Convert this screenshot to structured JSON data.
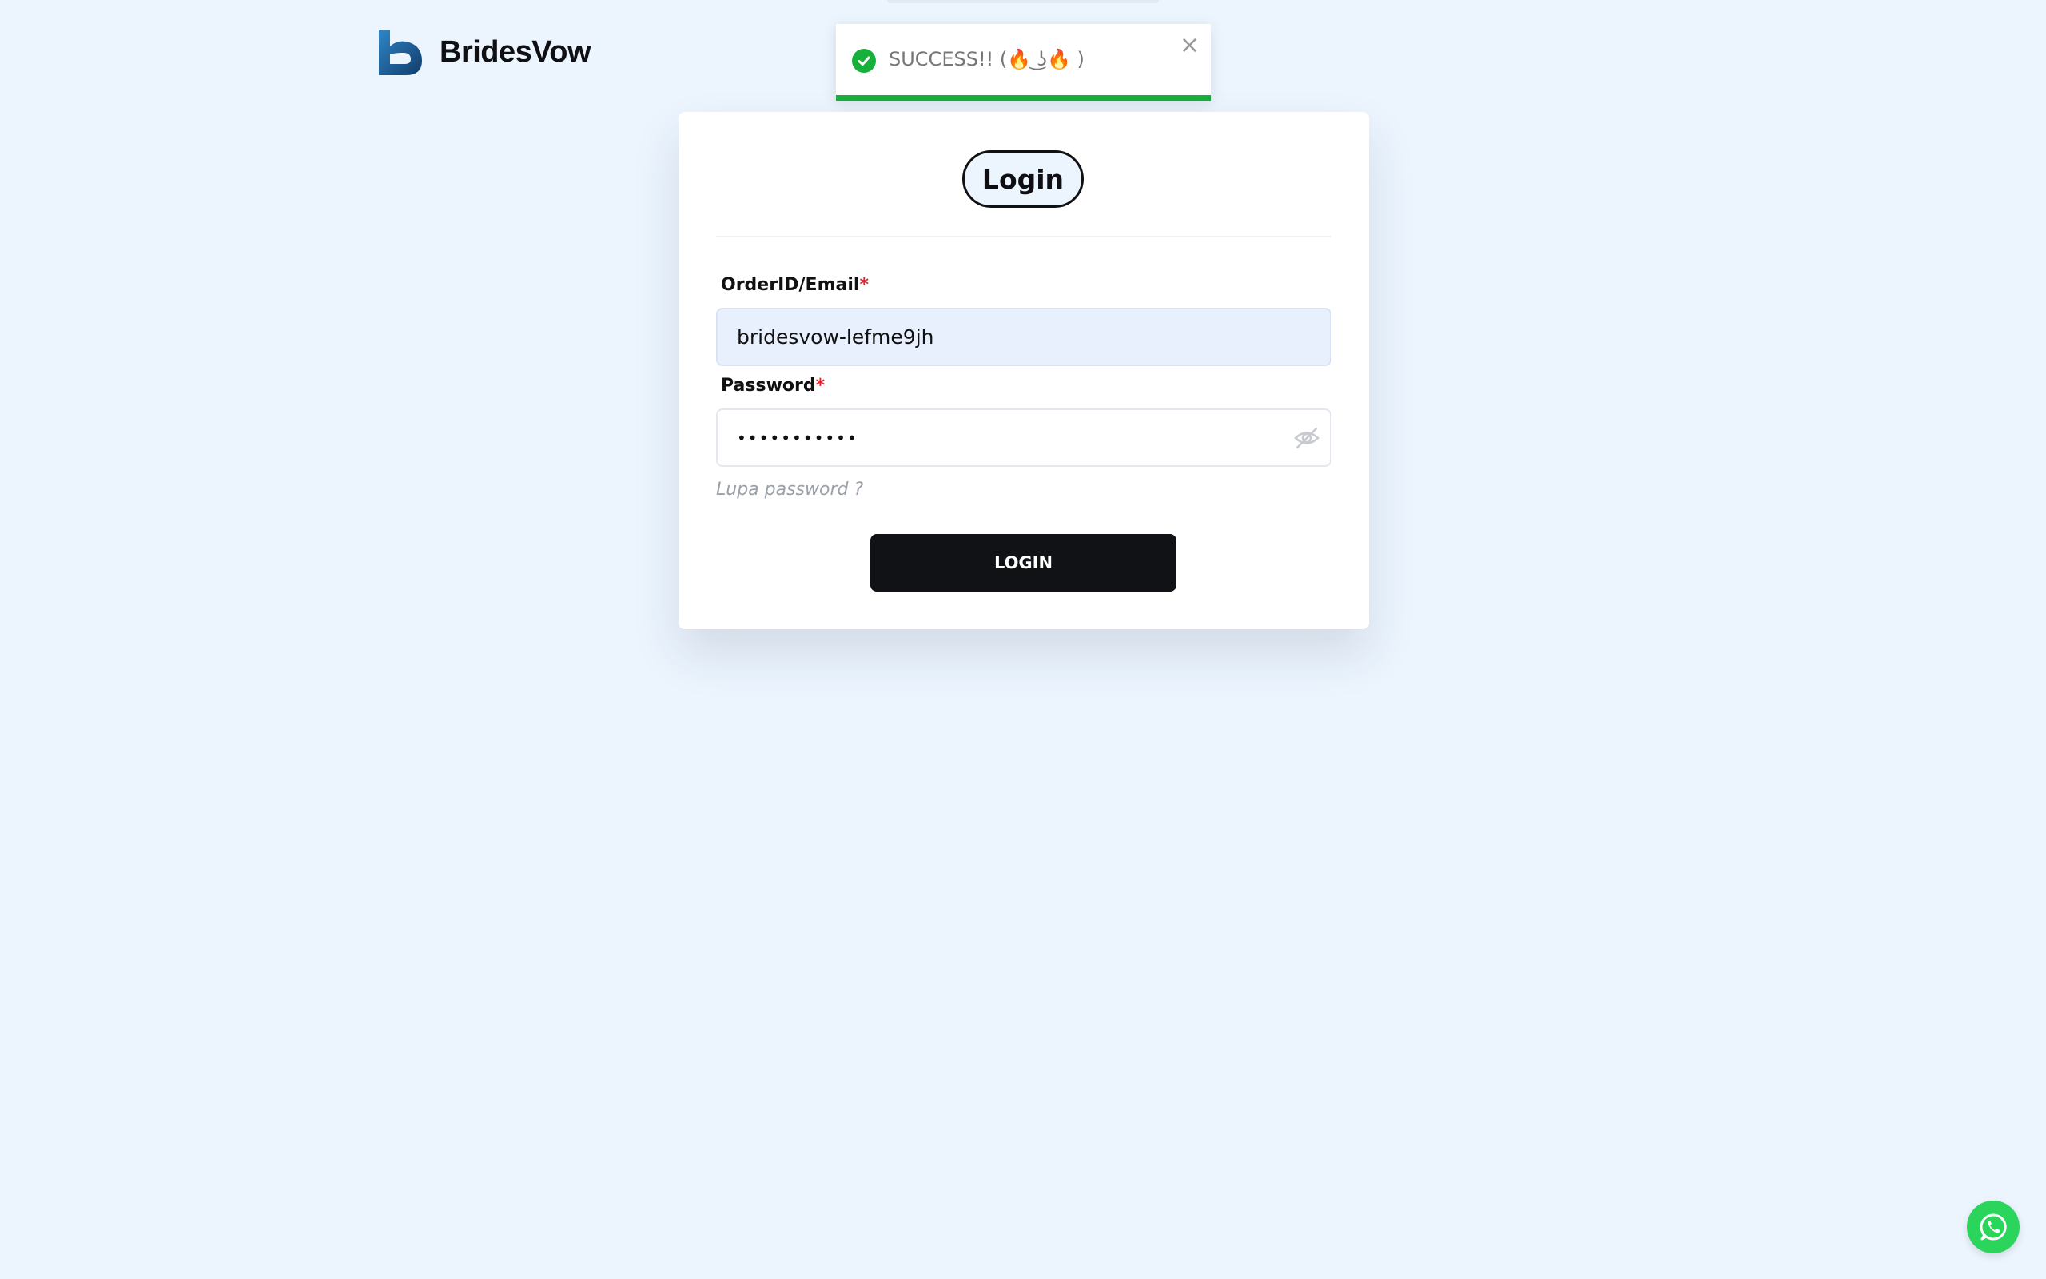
{
  "brand": {
    "name": "BridesVow",
    "logo_icon": "heart-b-logo-icon"
  },
  "toast": {
    "message": "SUCCESS!! (🔥 ͜ʖ🔥 )",
    "status": "success",
    "close_icon": "close-icon",
    "accent_color": "#17b03b",
    "progress": 1.0
  },
  "login": {
    "title": "Login",
    "order_label": "OrderID/Email",
    "order_value": "bridesvow-lefme9jh",
    "password_label": "Password",
    "password_mask": "•••••••••••",
    "required_marker": "*",
    "forgot_label": "Lupa password ?",
    "submit_label": "LOGIN",
    "eye_icon": "eye-off-icon"
  },
  "whatsapp": {
    "icon": "whatsapp-icon",
    "color": "#2bd45a"
  },
  "colors": {
    "background": "#ecf5fe",
    "button": "#111216",
    "required": "#e4252f"
  }
}
